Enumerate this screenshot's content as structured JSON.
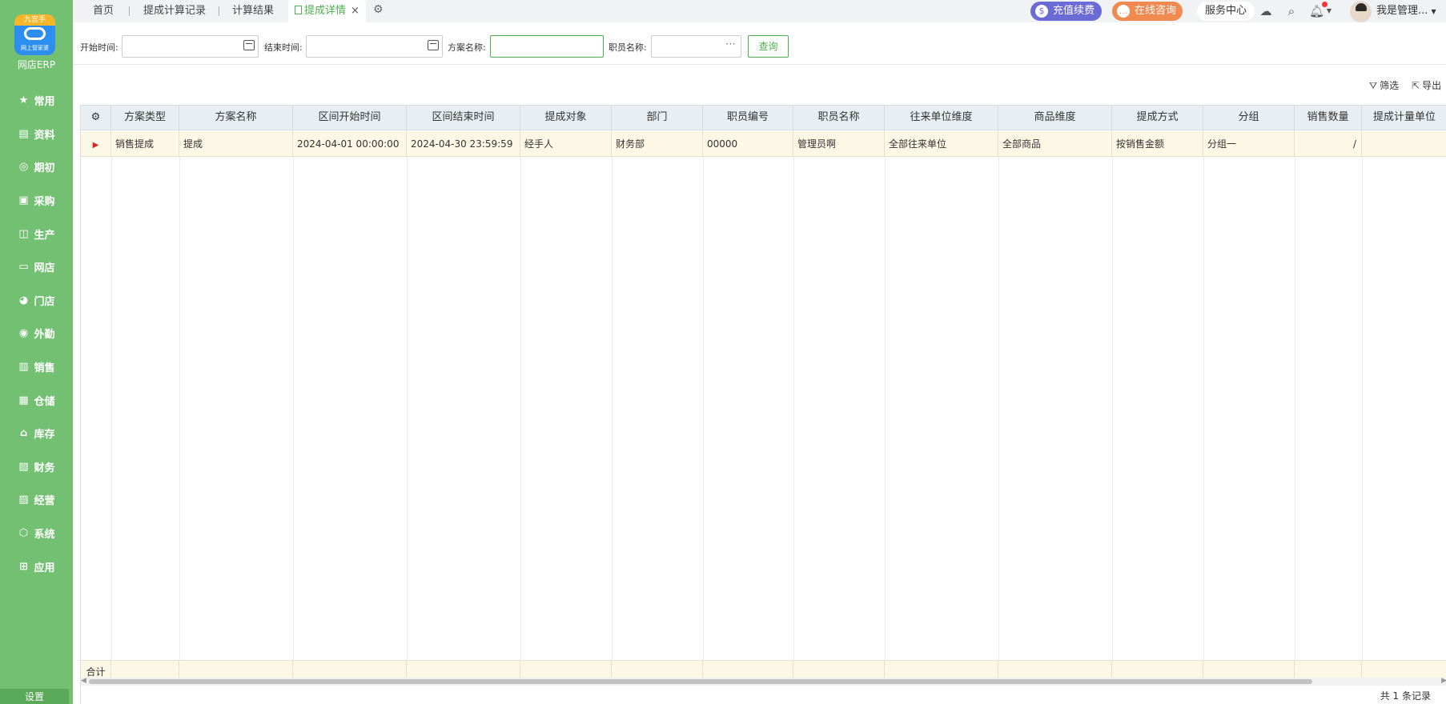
{
  "app": {
    "logo_badge": "九宫手",
    "logo_sub": "网上管家婆",
    "name": "网店ERP"
  },
  "sidebar": {
    "items": [
      {
        "label": "常用",
        "icon": "★"
      },
      {
        "label": "资料",
        "icon": "▤"
      },
      {
        "label": "期初",
        "icon": "◎"
      },
      {
        "label": "采购",
        "icon": "▣"
      },
      {
        "label": "生产",
        "icon": "◫"
      },
      {
        "label": "网店",
        "icon": "▭"
      },
      {
        "label": "门店",
        "icon": "◕"
      },
      {
        "label": "外勤",
        "icon": "◉"
      },
      {
        "label": "销售",
        "icon": "▥"
      },
      {
        "label": "仓储",
        "icon": "▦"
      },
      {
        "label": "库存",
        "icon": "⌂"
      },
      {
        "label": "财务",
        "icon": "▧"
      },
      {
        "label": "经营",
        "icon": "▨"
      },
      {
        "label": "系统",
        "icon": "⬡"
      },
      {
        "label": "应用",
        "icon": "⊞"
      }
    ],
    "settings": "设置"
  },
  "tabs": {
    "home": "首页",
    "t1": "提成计算记录",
    "t2": "计算结果",
    "active": "提成详情",
    "close": "×"
  },
  "topbar": {
    "recharge": "充值续费",
    "consult": "在线咨询",
    "service": "服务中心",
    "user": "我是管理..."
  },
  "filter": {
    "start_label": "开始时间:",
    "end_label": "结束时间:",
    "plan_label": "方案名称:",
    "staff_label": "职员名称:",
    "query": "查询"
  },
  "toolbar": {
    "filter": "筛选",
    "export": "导出"
  },
  "table": {
    "columns": [
      "方案类型",
      "方案名称",
      "区间开始时间",
      "区间结束时间",
      "提成对象",
      "部门",
      "职员编号",
      "职员名称",
      "往来单位维度",
      "商品维度",
      "提成方式",
      "分组",
      "销售数量",
      "提成计量单位"
    ],
    "rows": [
      [
        "销售提成",
        "提成",
        "2024-04-01 00:00:00",
        "2024-04-30 23:59:59",
        "经手人",
        "财务部",
        "00000",
        "管理员啊",
        "全部往来单位",
        "全部商品",
        "按销售金额",
        "分组一",
        "/",
        ""
      ]
    ],
    "footer_label": "合计",
    "record_count": "共 1 条记录"
  }
}
